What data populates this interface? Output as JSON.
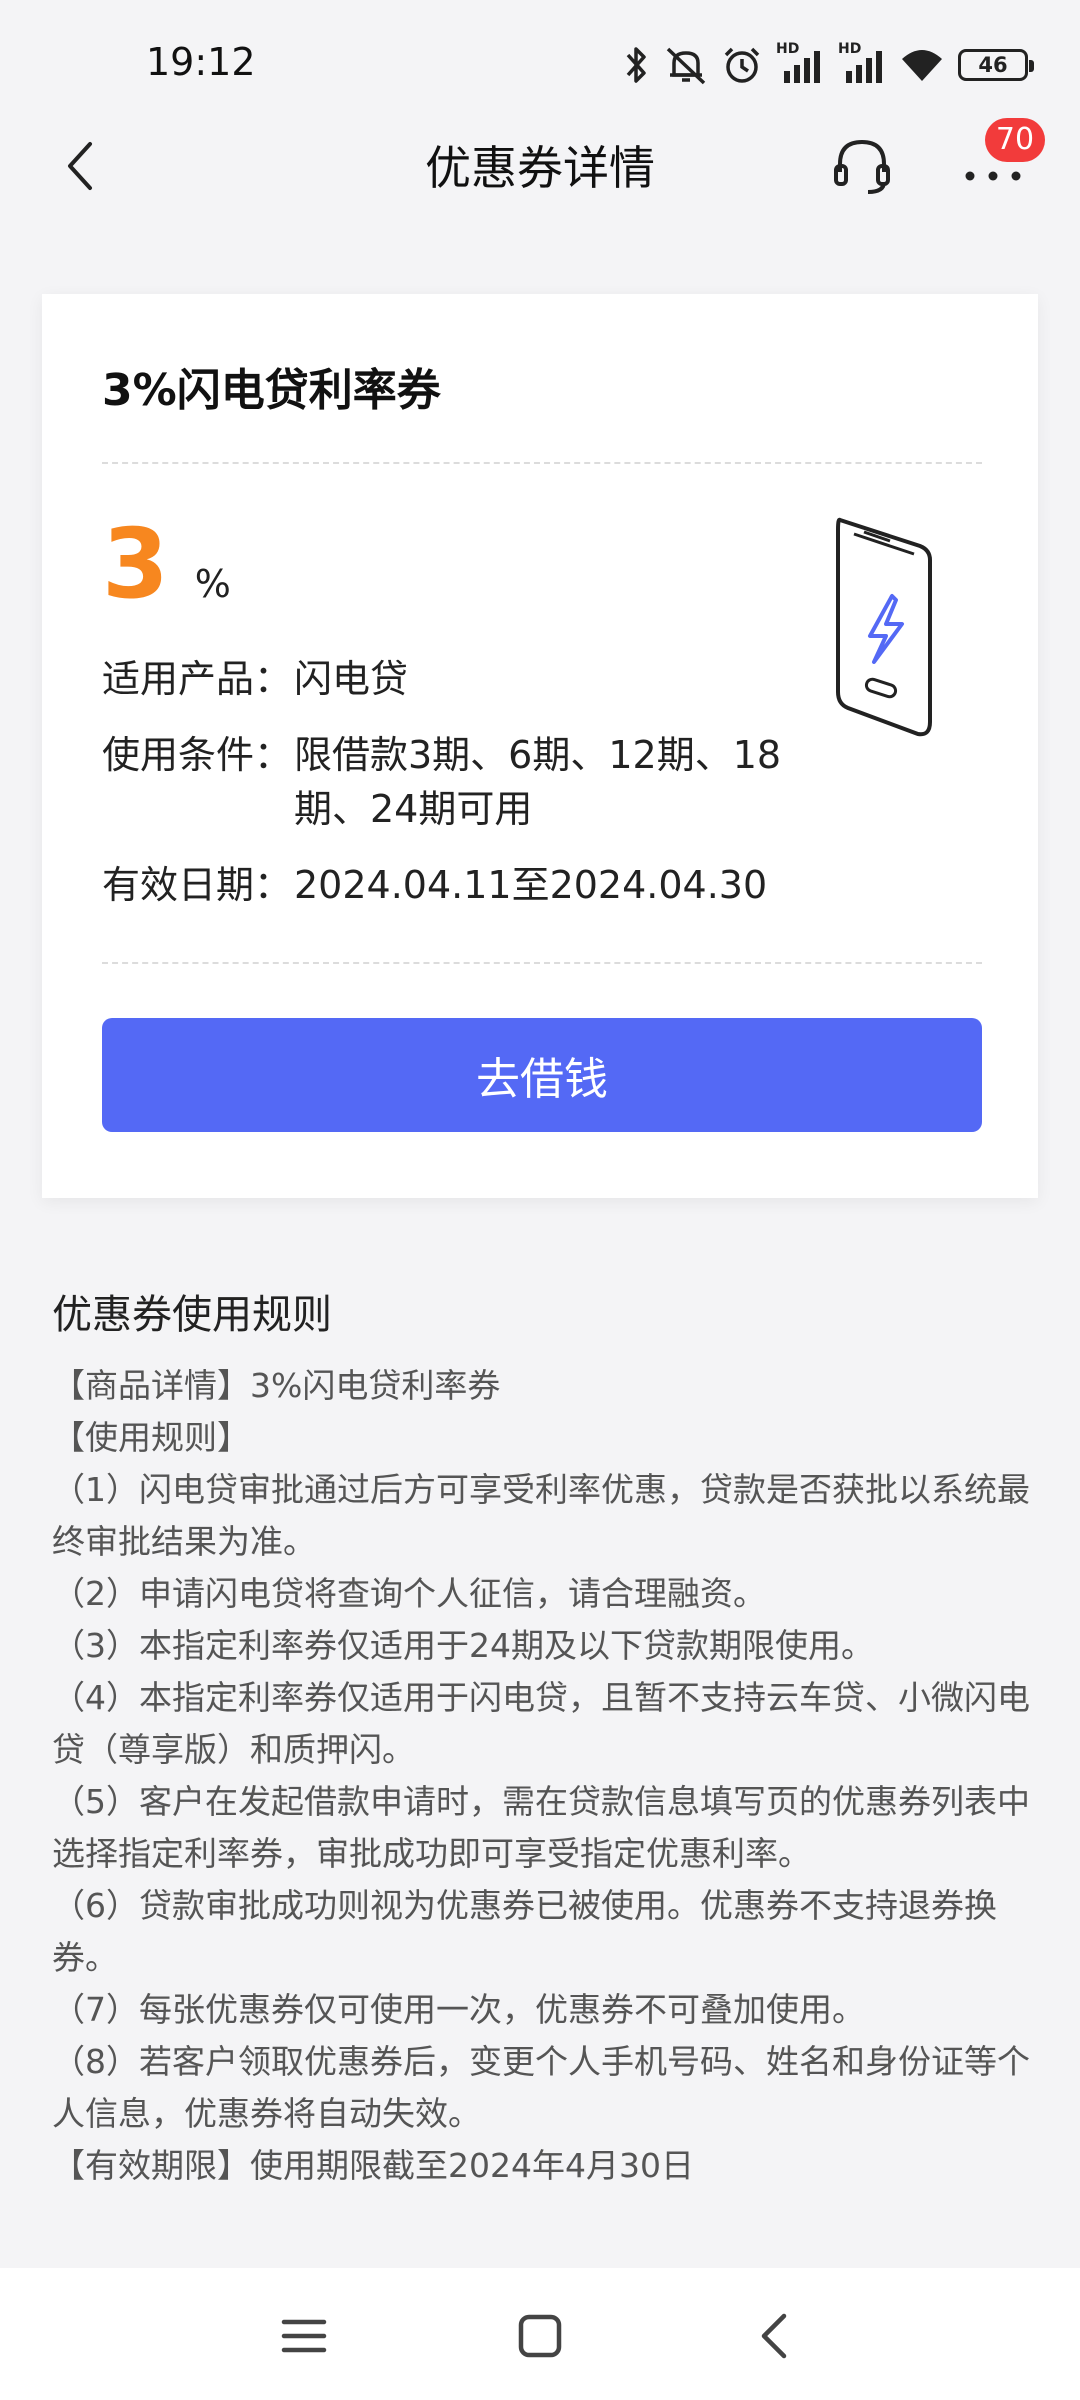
{
  "status_bar": {
    "time": "19:12",
    "network_label_1": "HD",
    "network_label_2": "HD",
    "battery": "46",
    "icons": [
      "bluetooth-icon",
      "mute-icon",
      "alarm-icon",
      "signal-icon",
      "signal-icon",
      "wifi-icon",
      "battery-icon"
    ]
  },
  "nav": {
    "title": "优惠券详情",
    "badge_count": "70",
    "icons": [
      "back-icon",
      "headset-icon",
      "more-icon"
    ]
  },
  "coupon": {
    "name": "3%闪电贷利率券",
    "rate_value": "3",
    "rate_unit": "%",
    "product_label": "适用产品：",
    "product_value": "闪电贷",
    "condition_label": "使用条件：",
    "condition_value": "限借款3期、6期、12期、18期、24期可用",
    "validity_label": "有效日期：",
    "validity_value": "2024.04.11至2024.04.30",
    "button_label": "去借钱",
    "accent_color": "#f7871f",
    "button_color": "#5469f5"
  },
  "rules": {
    "title": "优惠券使用规则",
    "lines": [
      "【商品详情】3%闪电贷利率券",
      "【使用规则】",
      "（1）闪电贷审批通过后方可享受利率优惠，贷款是否获批以系统最终审批结果为准。",
      "（2）申请闪电贷将查询个人征信，请合理融资。",
      "（3）本指定利率券仅适用于24期及以下贷款期限使用。",
      "（4）本指定利率券仅适用于闪电贷，且暂不支持云车贷、小微闪电贷（尊享版）和质押闪。",
      "（5）客户在发起借款申请时，需在贷款信息填写页的优惠券列表中选择指定利率券，审批成功即可享受指定优惠利率。",
      "（6）贷款审批成功则视为优惠券已被使用。优惠券不支持退券换券。",
      "（7）每张优惠券仅可使用一次，优惠券不可叠加使用。",
      "（8）若客户领取优惠券后，变更个人手机号码、姓名和身份证等个人信息，优惠券将自动失效。",
      "【有效期限】使用期限截至2024年4月30日"
    ]
  },
  "system_nav": {
    "icons": [
      "menu-icon",
      "home-icon",
      "back-icon"
    ]
  }
}
